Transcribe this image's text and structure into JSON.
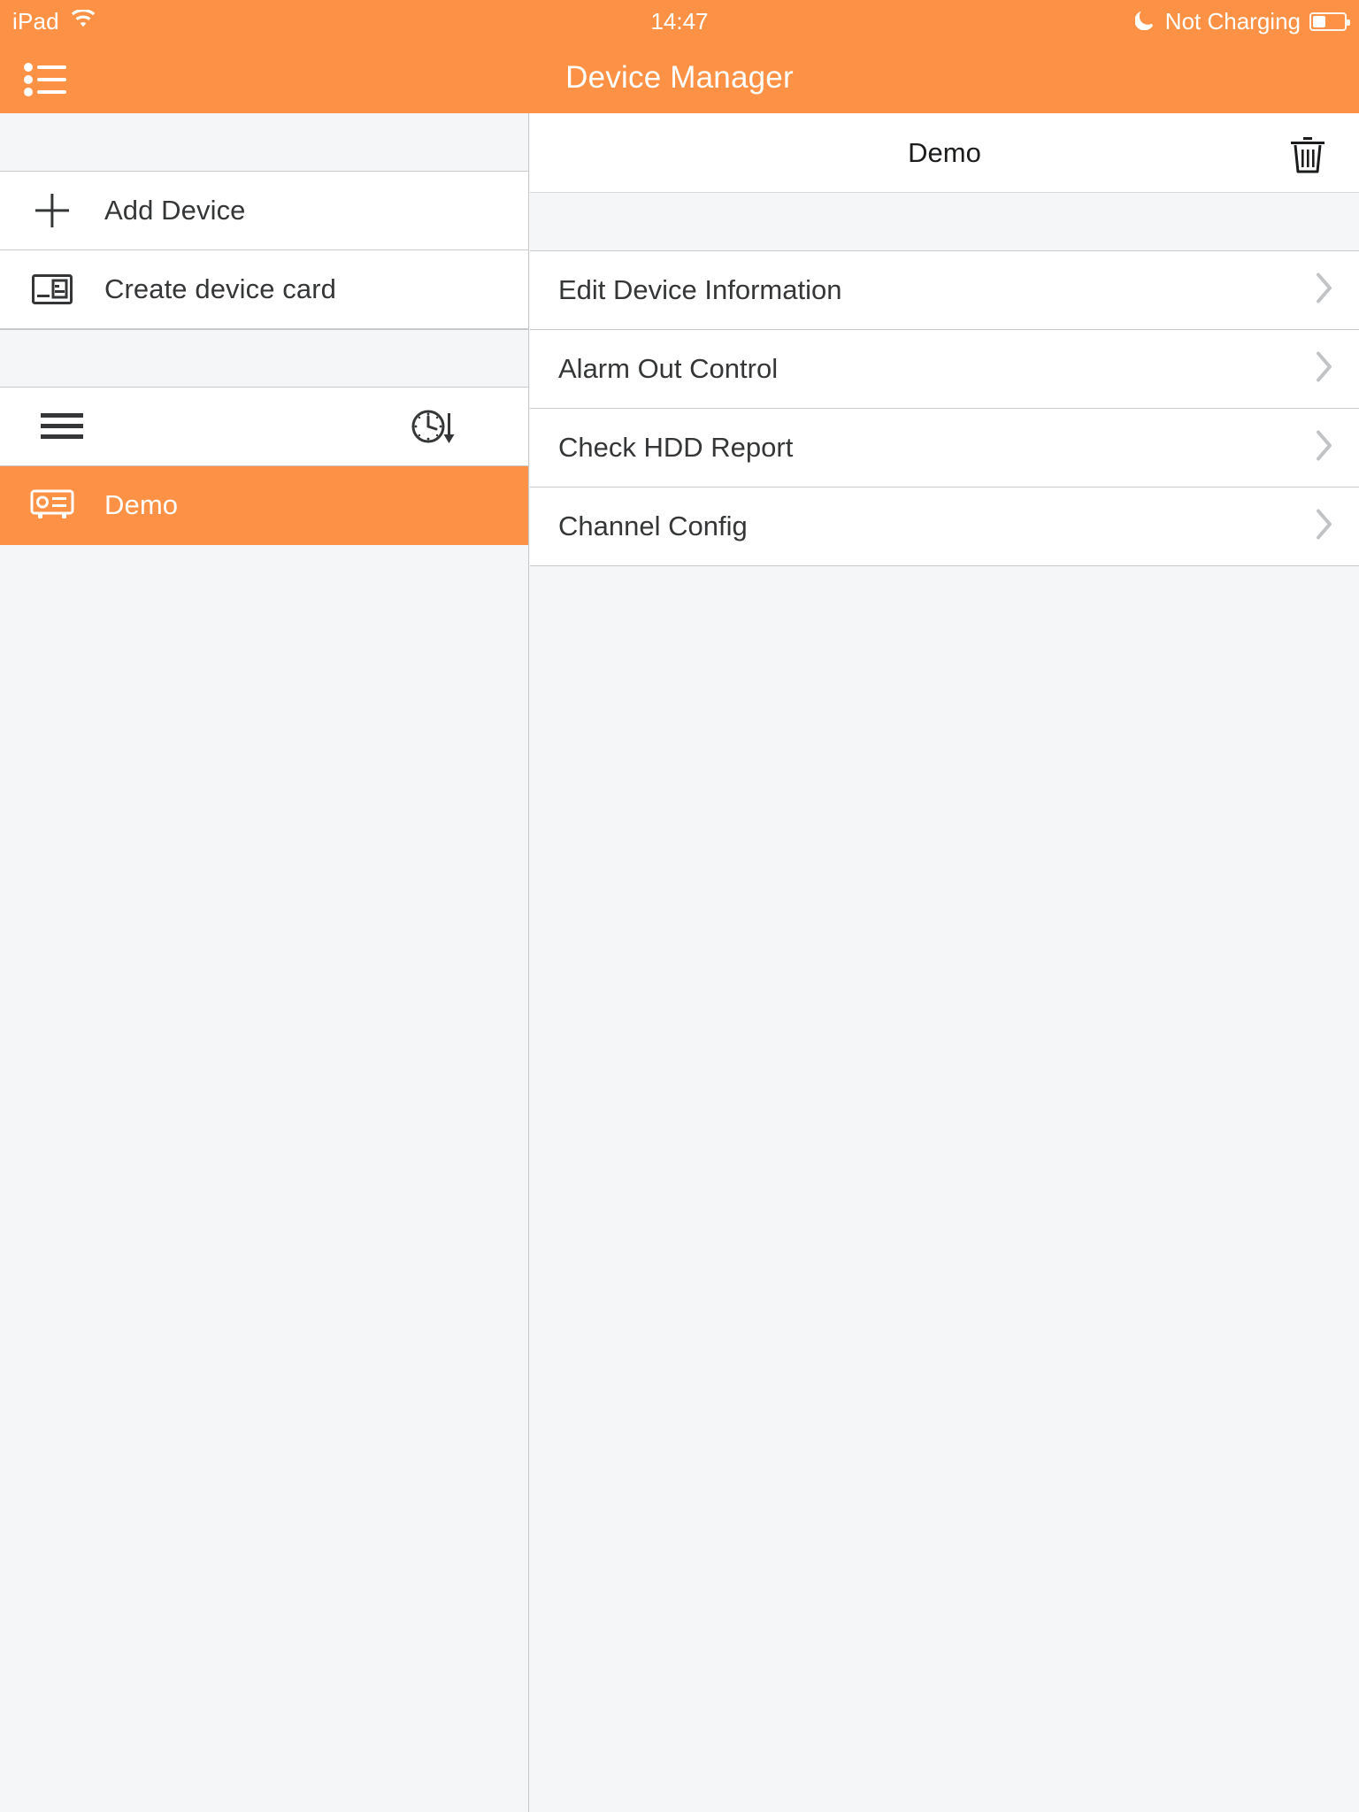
{
  "statusbar": {
    "device_label": "iPad",
    "wifi_icon": "wifi-icon",
    "time": "14:47",
    "dnd_icon": "moon-icon",
    "battery_label": "Not Charging",
    "battery_icon": "battery-icon",
    "battery_level_percent": 38
  },
  "navbar": {
    "title": "Device Manager",
    "menu_icon": "bulleted-list-icon",
    "background_color": "#fd9246",
    "text_color": "#ffffff"
  },
  "sidebar": {
    "items": [
      {
        "label": "Add Device",
        "icon": "plus-icon"
      },
      {
        "label": "Create device card",
        "icon": "device-card-icon"
      }
    ],
    "toolbar": {
      "list_icon": "hamburger-icon",
      "sort_icon": "clock-arrow-down-icon"
    },
    "devices": [
      {
        "label": "Demo",
        "icon": "dvr-device-icon",
        "selected": true
      }
    ]
  },
  "detail": {
    "title": "Demo",
    "delete_icon": "trash-icon",
    "menu": [
      {
        "label": "Edit Device Information",
        "chevron": "chevron-right-icon"
      },
      {
        "label": "Alarm Out Control",
        "chevron": "chevron-right-icon"
      },
      {
        "label": "Check HDD Report",
        "chevron": "chevron-right-icon"
      },
      {
        "label": "Channel Config",
        "chevron": "chevron-right-icon"
      }
    ]
  },
  "theme": {
    "accent": "#fd9246",
    "page_background": "#f5f6f7",
    "row_background": "#ffffff",
    "separator": "#c8c9cb",
    "text_primary": "#343637",
    "chevron_color": "#c2c3c5"
  }
}
